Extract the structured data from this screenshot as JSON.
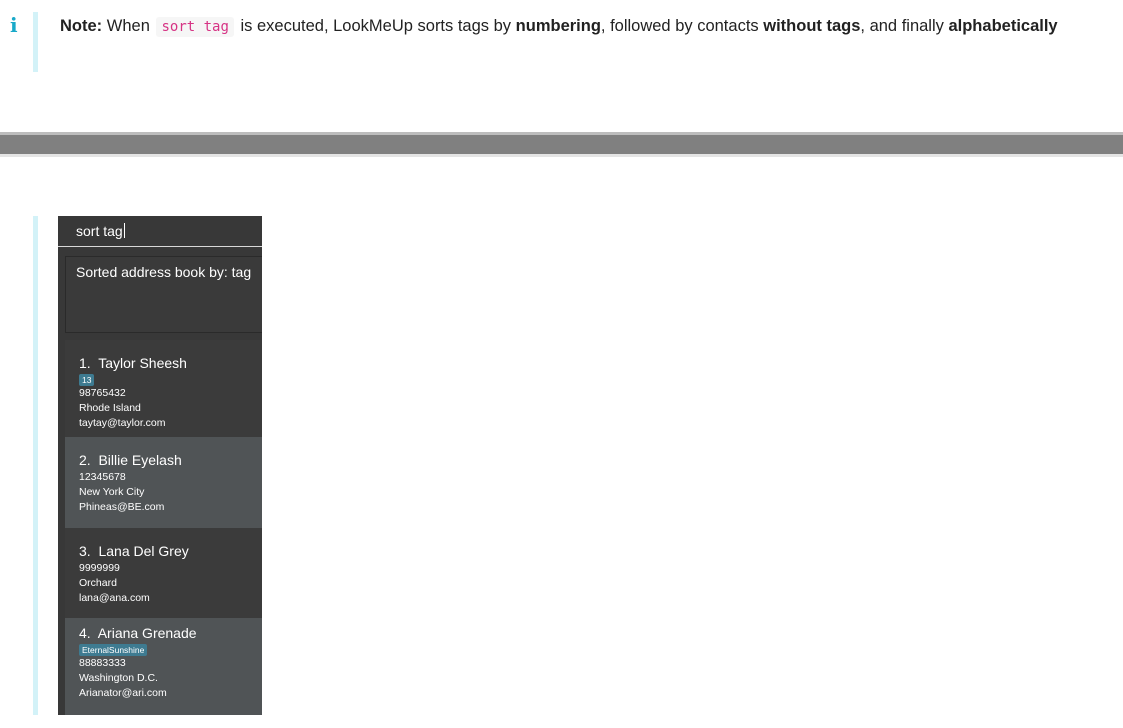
{
  "note": {
    "icon": "info-icon",
    "icon_glyph": "i",
    "label": "Note:",
    "text_1": "When",
    "code": "sort tag",
    "text_2": "is executed, LookMeUp sorts tags by",
    "bold_1": "numbering",
    "text_3": ", followed by contacts",
    "bold_2": "without tags",
    "text_4": ", and finally",
    "bold_3": "alphabetically"
  },
  "app": {
    "command_input": "sort tag",
    "result_message": "Sorted address book by: tag",
    "contacts": [
      {
        "index": "1.",
        "name": "Taylor Sheesh",
        "tag": "13",
        "phone": "98765432",
        "address": "Rhode Island",
        "email": "taytay@taylor.com"
      },
      {
        "index": "2.",
        "name": "Billie Eyelash",
        "phone": "12345678",
        "address": "New York City",
        "email": "Phineas@BE.com"
      },
      {
        "index": "3.",
        "name": "Lana Del Grey",
        "phone": "9999999",
        "address": "Orchard",
        "email": "lana@ana.com"
      },
      {
        "index": "4.",
        "name": "Ariana Grenade",
        "tag": "EternalSunshine",
        "phone": "88883333",
        "address": "Washington D.C.",
        "email": "Arianator@ari.com"
      }
    ]
  },
  "colors": {
    "accent": "#19a9c9",
    "admonition_bar": "#d3f2f8",
    "code_text": "#d63384",
    "tag_bg": "#3e7b91",
    "app_bg": "#383838",
    "card_light": "#505456"
  }
}
